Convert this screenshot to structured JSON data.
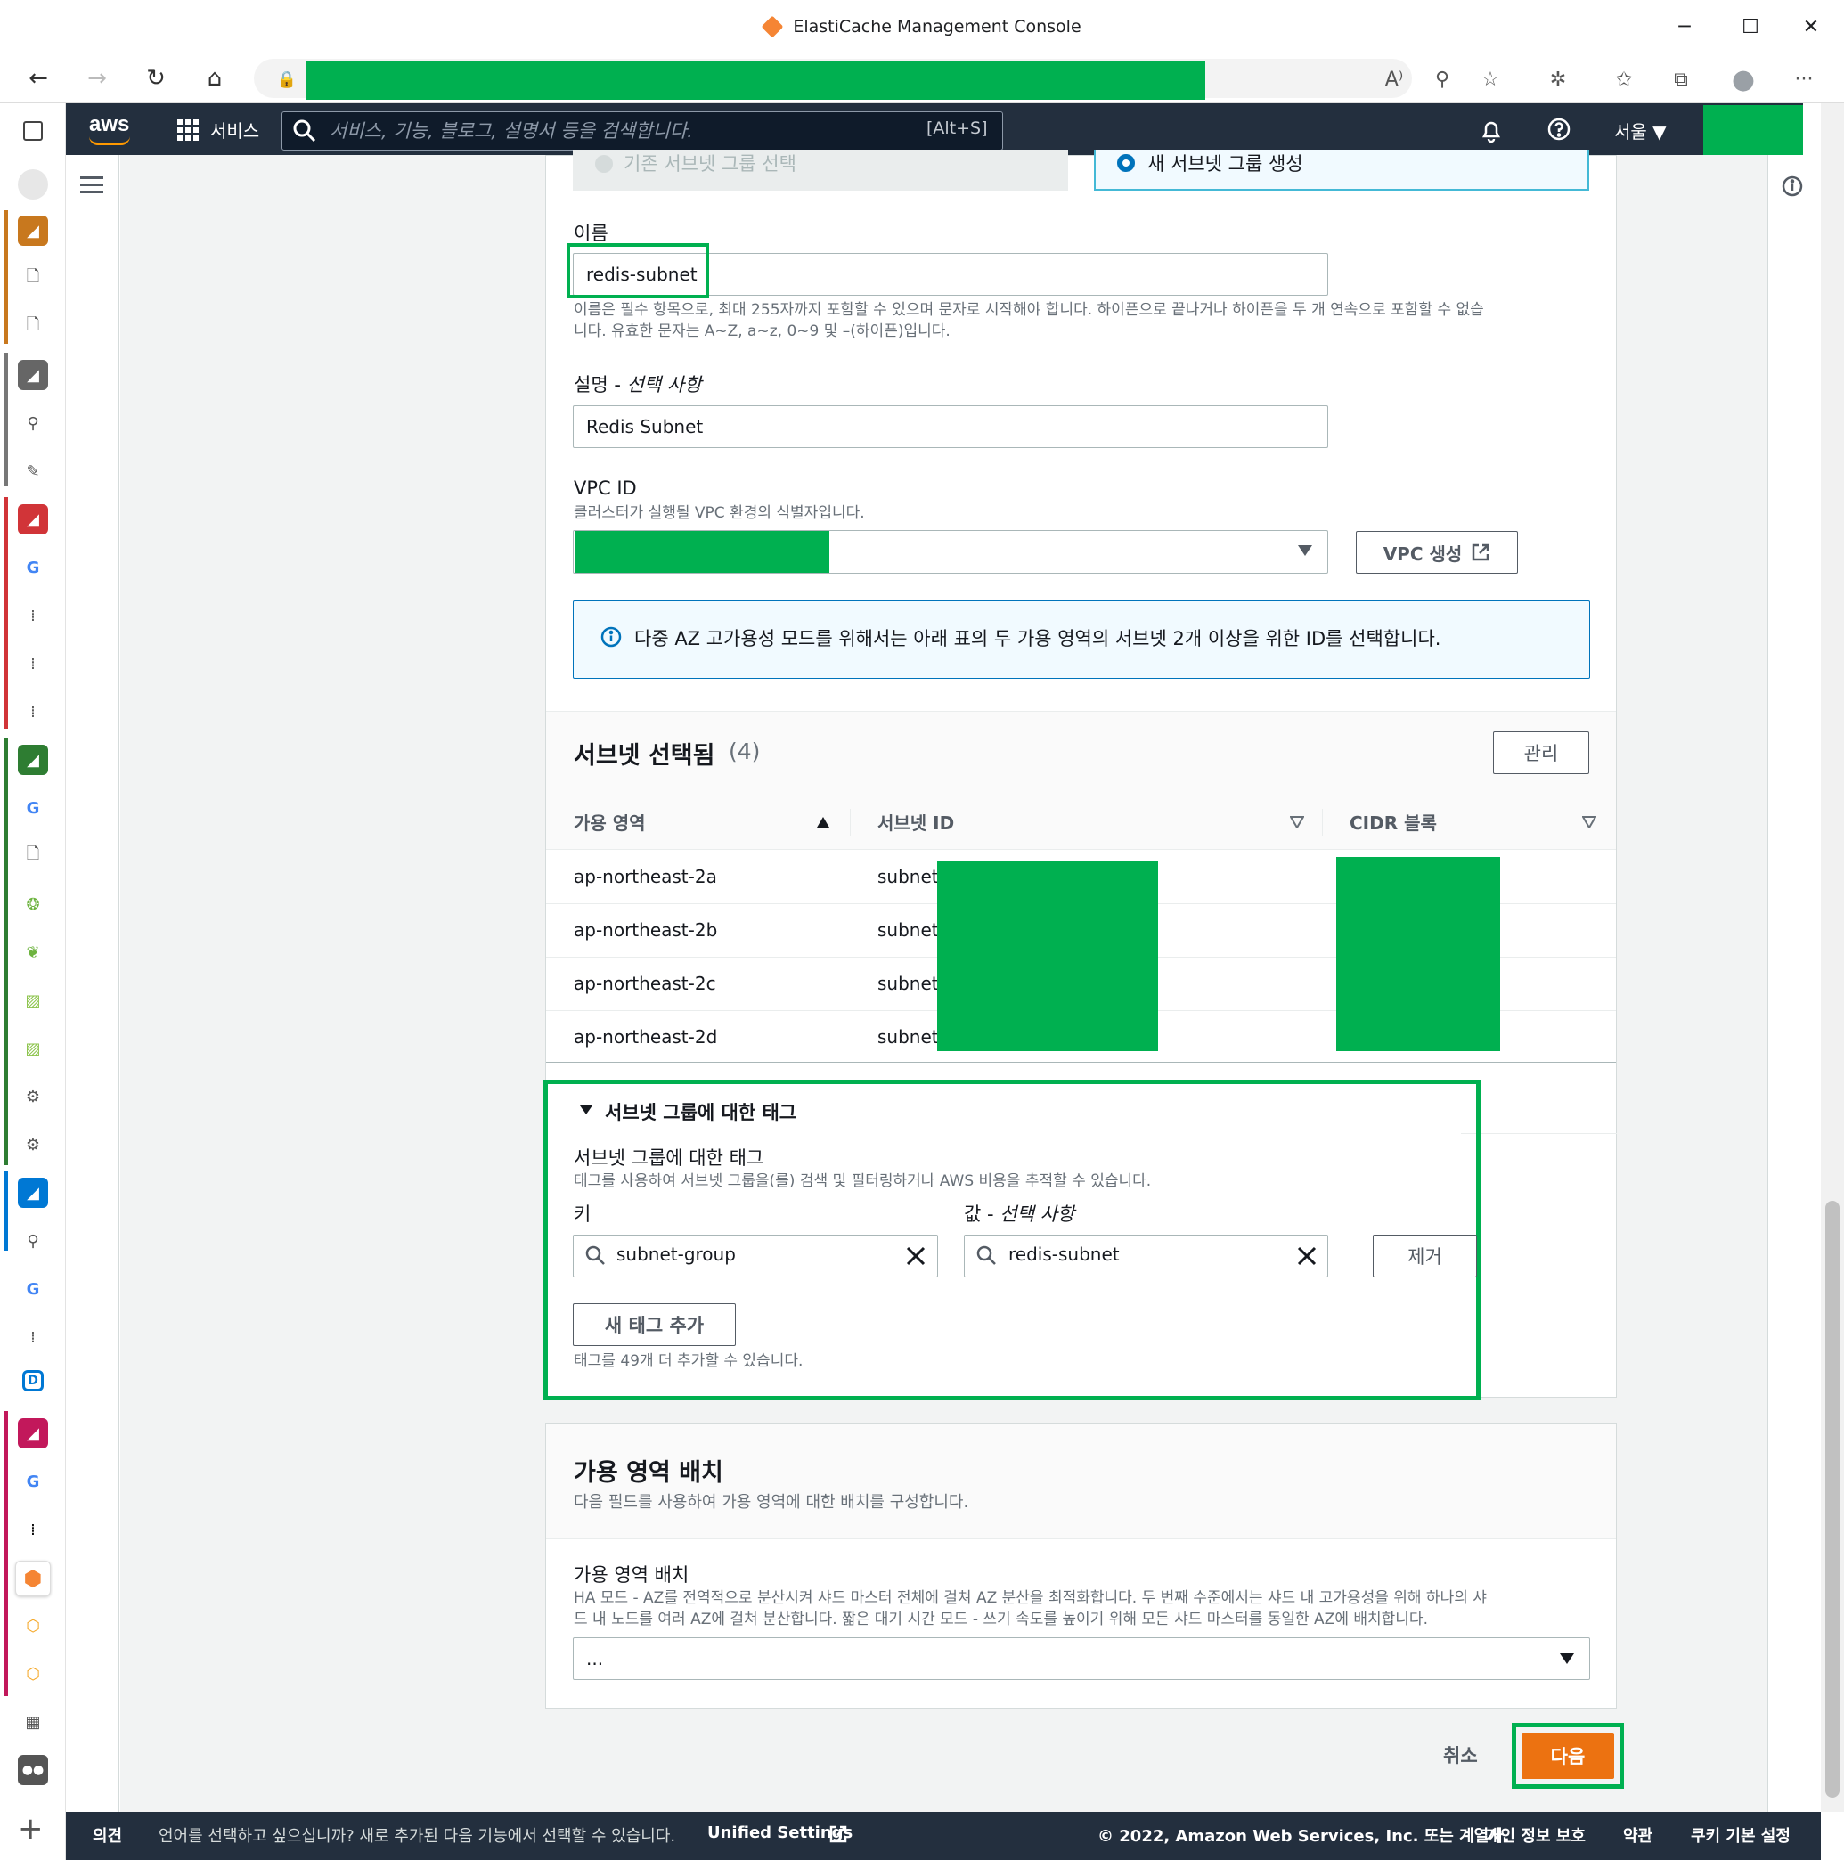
{
  "window": {
    "title": "ElastiCache Management Console",
    "minimize": "─",
    "maximize": "☐",
    "close": "✕"
  },
  "toolbar": {
    "back": "←",
    "forward": "→",
    "refresh": "↻",
    "home": "⌂",
    "lock": "🔒",
    "read_aloud": "A⁾",
    "profile_switch": "⚲",
    "favorite_add": "☆",
    "extensions": "✲",
    "favorites": "✩",
    "collections": "⧉",
    "avatar": "●",
    "more": "···"
  },
  "aws_nav": {
    "logo": "aws",
    "services_label": "서비스",
    "search_placeholder": "서비스, 기능, 블로그, 설명서 등을 검색합니다.",
    "search_shortcut": "[Alt+S]",
    "region": "서울 ▼"
  },
  "form": {
    "radio_existing": "기존 서브넷 그룹 선택",
    "radio_new": "새 서브넷 그룹 생성",
    "name_label": "이름",
    "name_value": "redis-subnet",
    "name_hint_1": "이름은 필수 항목으로, 최대 255자까지 포함할 수 있으며 문자로 시작해야 합니다. 하이픈으로 끝나거나 하이픈을 두 개 연속으로 포함할 수 없습",
    "name_hint_2": "니다. 유효한 문자는 A~Z, a~z, 0~9 및 –(하이픈)입니다.",
    "description_label": "설명 - ",
    "description_optional": "선택 사항",
    "description_value": "Redis Subnet",
    "vpc_label": "VPC ID",
    "vpc_hint": "클러스터가 실행될 VPC 환경의 식별자입니다.",
    "vpc_create_button": "VPC 생성",
    "info_alert": "다중 AZ 고가용성 모드를 위해서는 아래 표의 두 가용 영역의 서브넷 2개 이상을 위한 ID를 선택합니다."
  },
  "subnets": {
    "title": "서브넷 선택됨",
    "count": "(4)",
    "manage_button": "관리",
    "columns": [
      "가용 영역",
      "서브넷 ID",
      "CIDR 블록"
    ],
    "rows": [
      {
        "az": "ap-northeast-2a",
        "subnet": "subnet-"
      },
      {
        "az": "ap-northeast-2b",
        "subnet": "subnet-"
      },
      {
        "az": "ap-northeast-2c",
        "subnet": "subnet-"
      },
      {
        "az": "ap-northeast-2d",
        "subnet": "subnet-"
      }
    ]
  },
  "tags": {
    "section_toggle": "서브넷 그룹에 대한 태그",
    "label": "서브넷 그룹에 대한 태그",
    "hint": "태그를 사용하여 서브넷 그룹을(를) 검색 및 필터링하거나 AWS 비용을 추적할 수 있습니다.",
    "key_label": "키",
    "value_label": "값 - ",
    "value_optional": "선택 사항",
    "key_value": "subnet-group",
    "value_value": "redis-subnet",
    "remove_button": "제거",
    "add_button": "새 태그 추가",
    "remaining_hint": "태그를 49개 더 추가할 수 있습니다."
  },
  "az_placement": {
    "title": "가용 영역 배치",
    "description": "다음 필드를 사용하여 가용 영역에 대한 배치를 구성합니다.",
    "field_label": "가용 영역 배치",
    "field_hint_1": "HA 모드 - AZ를 전역적으로 분산시켜 샤드 마스터 전체에 걸쳐 AZ 분산을 최적화합니다. 두 번째 수준에서는 샤드 내 고가용성을 위해 하나의 샤",
    "field_hint_2": "드 내 노드를 여러 AZ에 걸쳐 분산합니다. 짧은 대기 시간 모드 - 쓰기 속도를 높이기 위해 모든 샤드 마스터를 동일한 AZ에 배치합니다.",
    "select_value": "..."
  },
  "actions": {
    "cancel": "취소",
    "next": "다음"
  },
  "footer": {
    "feedback": "의견",
    "language_prompt": "언어를 선택하고 싶으십니까? 새로 추가된 다음 기능에서 선택할 수 있습니다. ",
    "unified_settings": "Unified Settings",
    "copyright": "© 2022, Amazon Web Services, Inc. 또는 계열사.",
    "privacy": "개인 정보 보호",
    "terms": "약관",
    "cookies": "쿠키 기본 설정"
  },
  "colors": {
    "aws_nav": "#232f3e",
    "primary_button": "#ec7211",
    "info_blue": "#0073bb",
    "redaction_green": "#00b050"
  }
}
